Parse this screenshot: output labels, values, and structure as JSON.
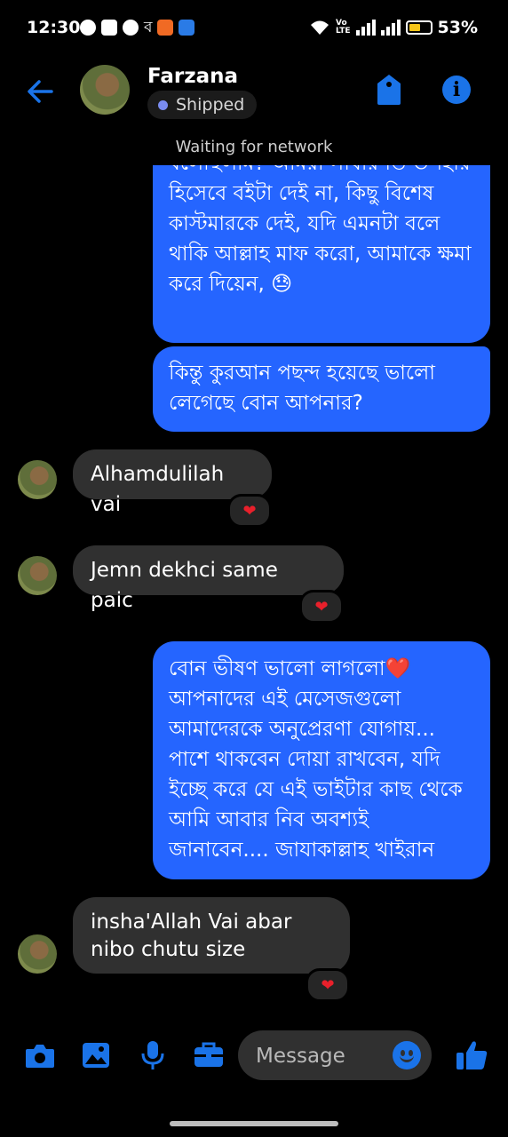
{
  "status_bar": {
    "time": "12:30",
    "battery": "53%",
    "battery_level": 0.53,
    "icons": [
      "whatsapp-icon",
      "youtube-icon",
      "messenger-icon",
      "bengali-app-icon",
      "orange-app-icon",
      "blue-app-icon",
      "wifi-icon",
      "volte-icon",
      "signal-icon",
      "battery-icon"
    ]
  },
  "header": {
    "contact_name": "Farzana",
    "label": "Shipped",
    "status": "Waiting for network"
  },
  "messages": [
    {
      "direction": "out",
      "text": "বলেছিলাম? আমরা সাধারণত উপহার হিসেবে বইটা দেই না, কিছু বিশেষ কাস্টমারকে দেই, যদি এমনটা বলে থাকি আল্লাহ মাফ করো, আমাকে ক্ষমা করে দিয়েন, 😓"
    },
    {
      "direction": "out",
      "text": "কিন্তু কুরআন পছন্দ হয়েছে ভালো লেগেছে বোন আপনার?"
    },
    {
      "direction": "in",
      "text": "Alhamdulilah vai",
      "reaction": "❤"
    },
    {
      "direction": "in",
      "text": "Jemn dekhci same paic",
      "reaction": "❤"
    },
    {
      "direction": "out",
      "text": "বোন ভীষণ ভালো লাগলো❤️ আপনাদের এই মেসেজগুলো আমাদেরকে অনুপ্রেরণা যোগায়... পাশে থাকবেন দোয়া রাখবেন, যদি ইচ্ছে করে যে এই ভাইটার কাছ থেকে আমি আবার নিব অবশ্যই জানাবেন.... জাযাকাল্লাহ খাইরান"
    },
    {
      "direction": "in",
      "text": "insha'Allah Vai abar nibo chutu size",
      "reaction": "❤"
    }
  ],
  "composer": {
    "placeholder": "Message",
    "icons": [
      "camera-icon",
      "gallery-icon",
      "microphone-icon",
      "briefcase-icon",
      "emoji-icon",
      "thumbs-up-icon"
    ]
  },
  "colors": {
    "accent": "#1a73e8",
    "outgoing_bubble": "#2565ff",
    "incoming_bubble": "#303030",
    "reaction_heart": "#e8202b",
    "background": "#000000"
  }
}
